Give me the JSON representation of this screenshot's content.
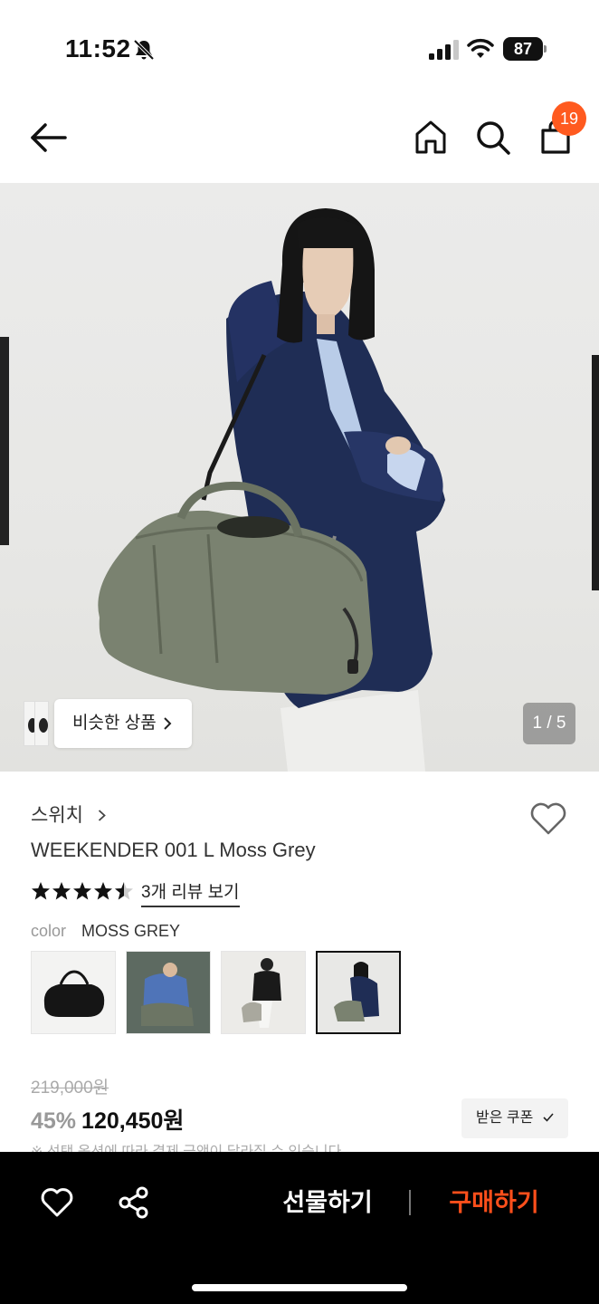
{
  "status_bar": {
    "time": "11:52",
    "battery": "87",
    "icons": [
      "bell-off-icon",
      "signal-icon",
      "wifi-icon",
      "battery-icon"
    ]
  },
  "header": {
    "icons": [
      "back-arrow-icon",
      "home-icon",
      "search-icon",
      "shopping-bag-icon"
    ],
    "cart_count": "19"
  },
  "gallery": {
    "similar_label": "비슷한 상품",
    "counter": "1 / 5"
  },
  "product": {
    "brand": "스위치",
    "name": "WEEKENDER 001 L Moss Grey",
    "rating": 4.5,
    "review_link": "3개 리뷰 보기",
    "color_label": "color",
    "color_value": "MOSS GREY",
    "swatch_count": 4,
    "selected_swatch": 4,
    "original_price": "219,000원",
    "discount": "45%",
    "sale_price": "120,450원",
    "coupon_label": "받은 쿠폰",
    "notice": "※ 선택 옵션에 따라 결제 금액이 달라질 수 있습니다"
  },
  "bottom_bar": {
    "gift_label": "선물하기",
    "buy_label": "구매하기",
    "icons": [
      "heart-icon",
      "share-icon"
    ]
  },
  "colors": {
    "accent": "#ff5a1f",
    "buy": "#ff4f1b",
    "bar_background": "#000000"
  }
}
